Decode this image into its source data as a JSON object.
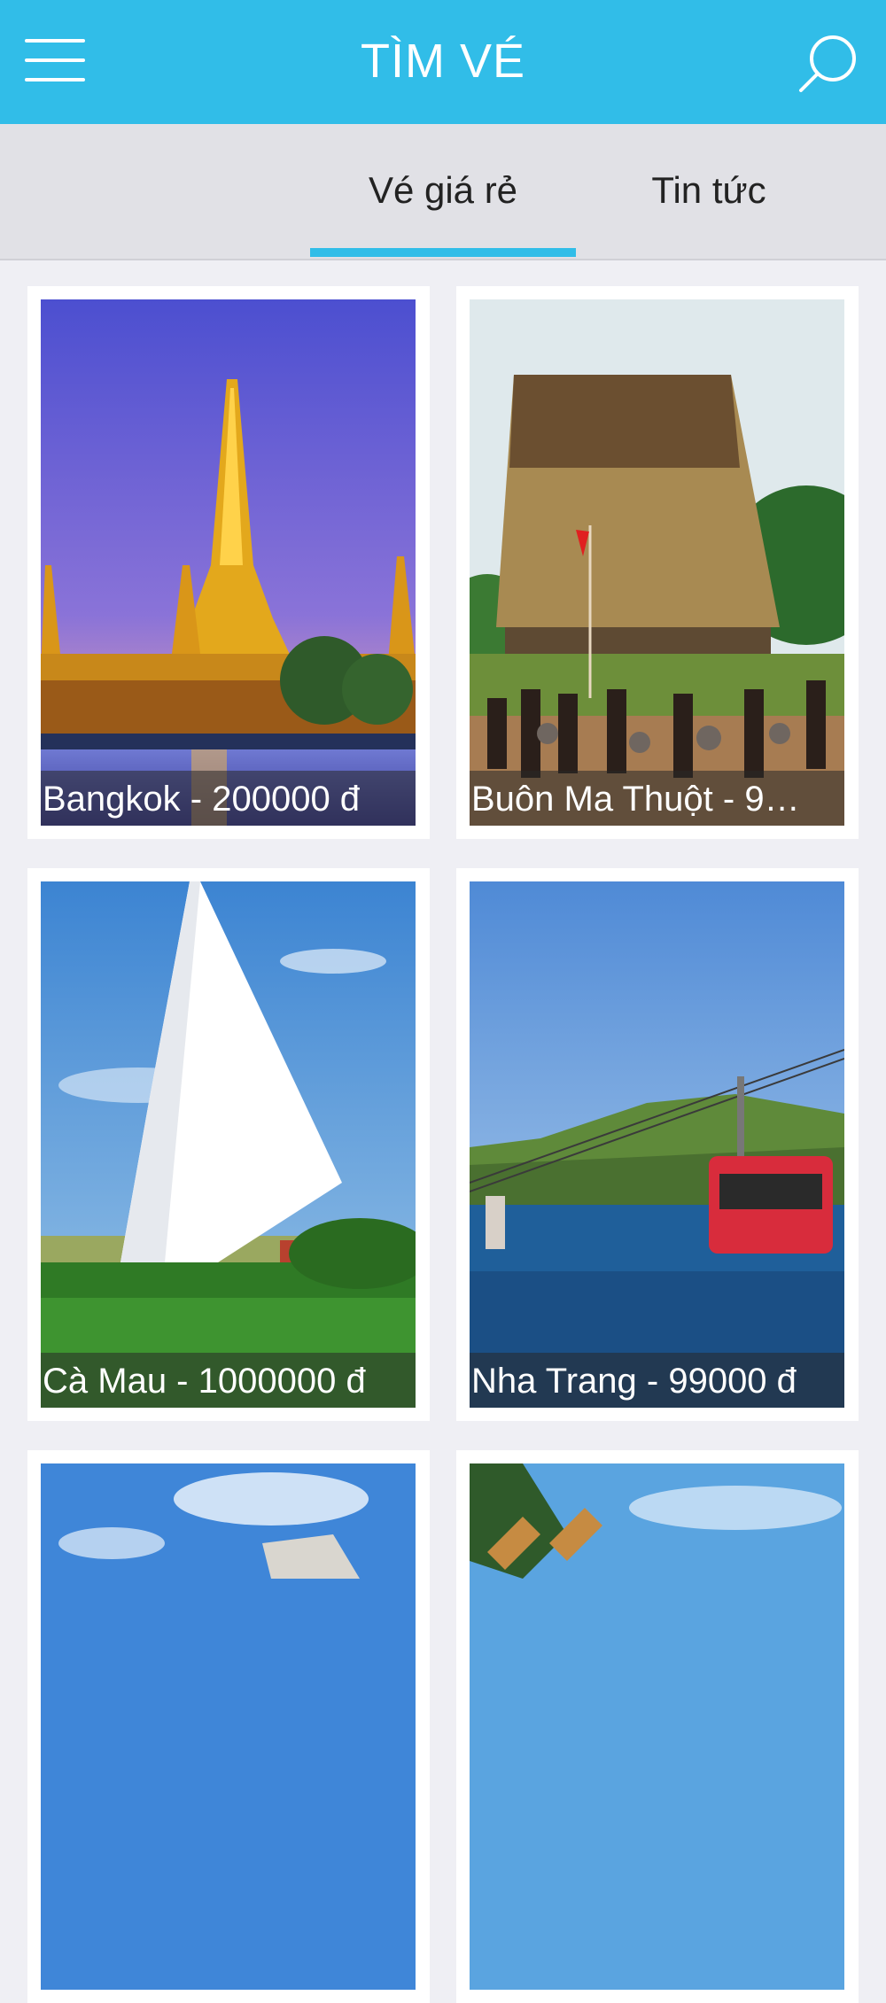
{
  "header": {
    "title": "TÌM VÉ",
    "menu_icon": "hamburger-menu-icon",
    "search_icon": "search-icon",
    "color": "#31bde8"
  },
  "tabs": [
    {
      "label": "Vé giá rẻ",
      "active": true
    },
    {
      "label": "Tin tức",
      "active": false
    }
  ],
  "tickets": [
    {
      "caption": "Bangkok - 200000 đ",
      "photo": "bangkok-temple-photo"
    },
    {
      "caption": "Buôn Ma Thuột - 9…",
      "photo": "buon-ma-thuot-longhouse-photo"
    },
    {
      "caption": "Cà Mau - 1000000 đ",
      "photo": "ca-mau-monument-photo"
    },
    {
      "caption": "Nha Trang - 99000 đ",
      "photo": "nha-trang-cable-car-photo"
    },
    {
      "caption": "",
      "photo": "city-skyline-photo"
    },
    {
      "caption": "",
      "photo": "windmill-photo"
    }
  ]
}
